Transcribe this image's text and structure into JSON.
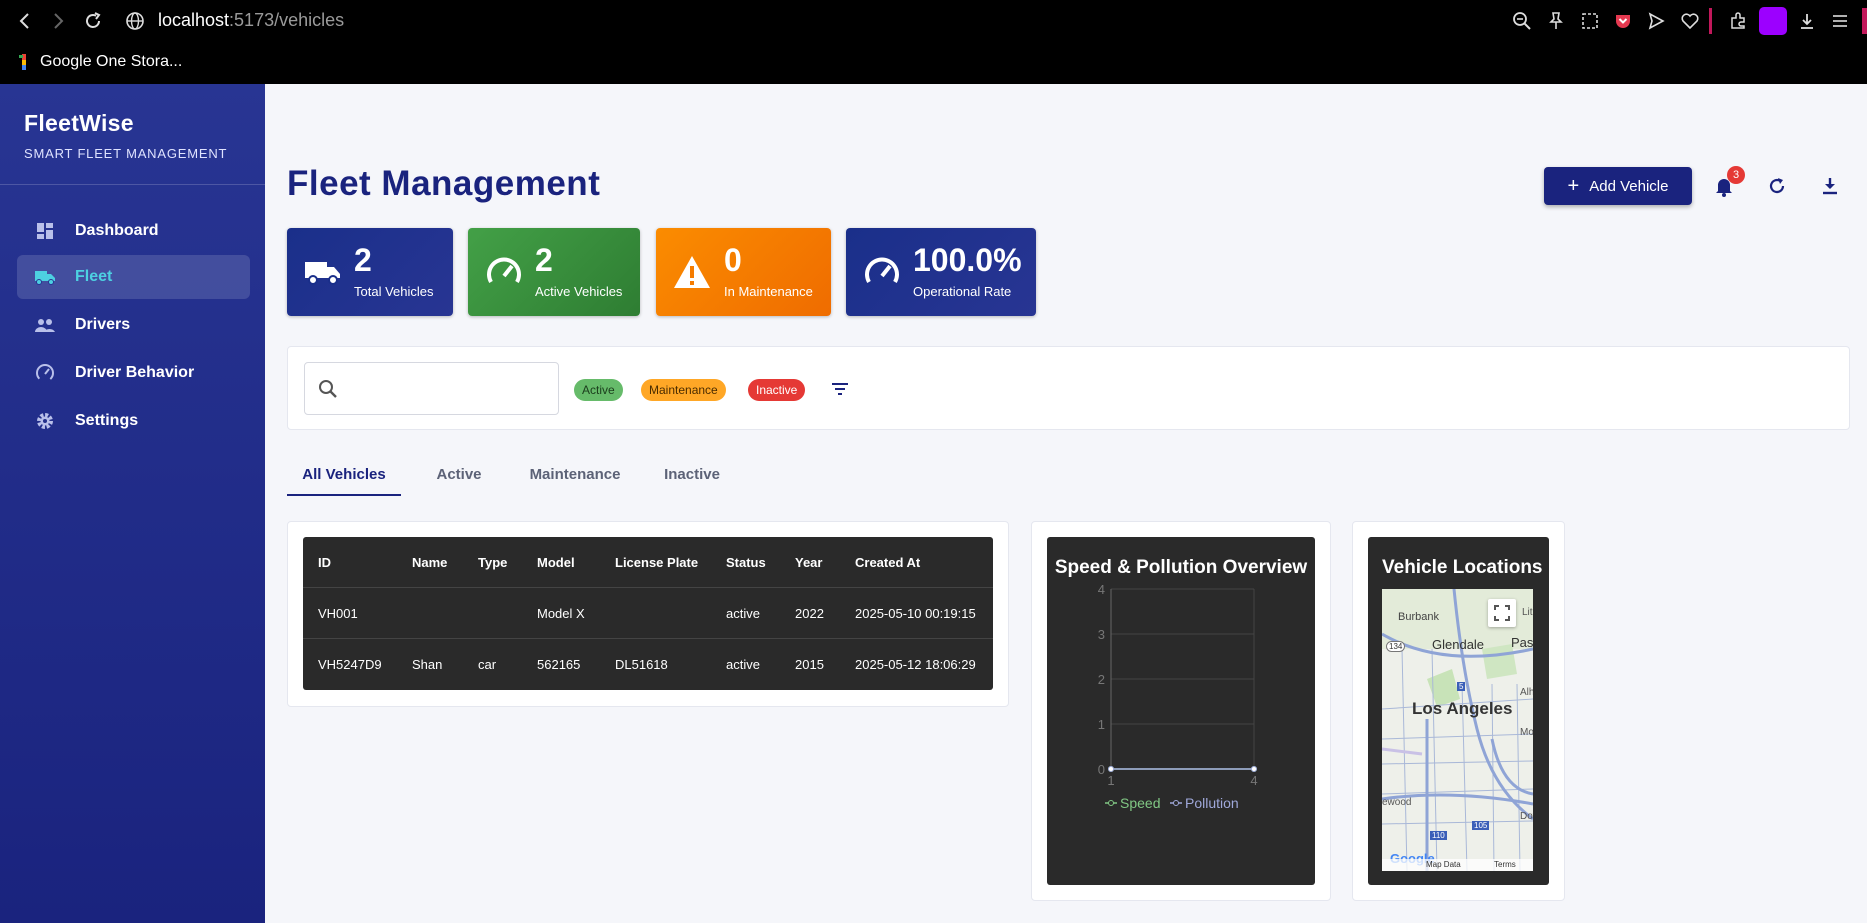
{
  "browser": {
    "url_host": "localhost",
    "url_rest": ":5173/vehicles",
    "bookmark": "Google One Stora..."
  },
  "sidebar": {
    "brand": "FleetWise",
    "subtitle": "SMART FLEET MANAGEMENT",
    "items": [
      {
        "label": "Dashboard",
        "icon": "dashboard-icon"
      },
      {
        "label": "Fleet",
        "icon": "truck-icon",
        "active": true
      },
      {
        "label": "Drivers",
        "icon": "people-icon"
      },
      {
        "label": "Driver Behavior",
        "icon": "speedometer-icon"
      },
      {
        "label": "Settings",
        "icon": "gear-icon"
      }
    ]
  },
  "header": {
    "title": "Fleet Management",
    "add_button": "Add Vehicle",
    "notification_count": "3"
  },
  "stats": [
    {
      "value": "2",
      "label": "Total Vehicles",
      "color": "#1a2f8a"
    },
    {
      "value": "2",
      "label": "Active Vehicles",
      "color": "#3a9a3e"
    },
    {
      "value": "0",
      "label": "In Maintenance",
      "color": "#f57c00"
    },
    {
      "value": "100.0%",
      "label": "Operational Rate",
      "color": "#1a2f8a"
    }
  ],
  "filters": {
    "search_placeholder": "",
    "chips": [
      {
        "label": "Active",
        "bg": "#66bb6a",
        "fg": "#1b3d1c"
      },
      {
        "label": "Maintenance",
        "bg": "#ffa726",
        "fg": "#4a2c00"
      },
      {
        "label": "Inactive",
        "bg": "#e53935",
        "fg": "#ffffff"
      }
    ]
  },
  "tabs": [
    "All Vehicles",
    "Active",
    "Maintenance",
    "Inactive"
  ],
  "table": {
    "columns": [
      "ID",
      "Name",
      "Type",
      "Model",
      "License Plate",
      "Status",
      "Year",
      "Created At"
    ],
    "rows": [
      [
        "VH001",
        "",
        "",
        "Model X",
        "",
        "active",
        "2022",
        "2025-05-10 00:19:15"
      ],
      [
        "VH5247D9",
        "Shan",
        "car",
        "562165",
        "DL51618",
        "active",
        "2015",
        "2025-05-12 18:06:29"
      ]
    ]
  },
  "chart_data": {
    "type": "line",
    "title": "Speed & Pollution Overview",
    "x": [
      1,
      4
    ],
    "xticks": [
      "1",
      "4"
    ],
    "yticks": [
      "0",
      "1",
      "2",
      "3",
      "4"
    ],
    "ylim": [
      0,
      4
    ],
    "series": [
      {
        "name": "Speed",
        "values": [
          0,
          0
        ],
        "color": "#81c784"
      },
      {
        "name": "Pollution",
        "values": [
          0,
          0
        ],
        "color": "#9fa8da"
      }
    ]
  },
  "map": {
    "title": "Vehicle Locations",
    "labels": [
      "Burbank",
      "Glendale",
      "Pasa",
      "Los Angeles",
      "Alh",
      "Mo",
      "Dov",
      "ewood",
      "Lit"
    ],
    "shields": [
      "134",
      "5",
      "110",
      "105"
    ],
    "footer_google": "Google",
    "footer_data": "Map Data",
    "footer_terms": "Terms"
  }
}
